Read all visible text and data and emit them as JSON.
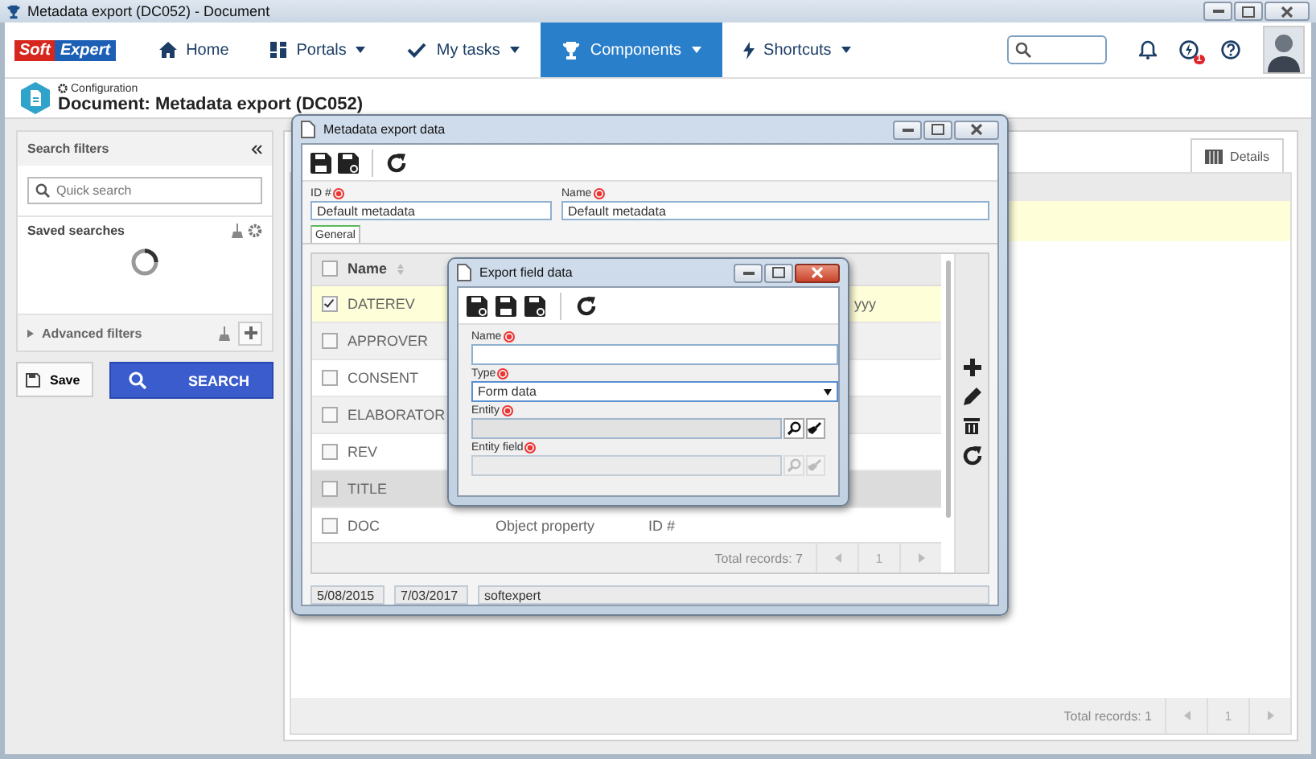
{
  "window": {
    "title": "Metadata export (DC052) - Document"
  },
  "logo": {
    "left": "Soft",
    "right": "Expert"
  },
  "nav": [
    {
      "kind": "home",
      "label": "Home",
      "menu": false,
      "selected": false
    },
    {
      "kind": "portals",
      "label": "Portals",
      "menu": true,
      "selected": false
    },
    {
      "kind": "tasks",
      "label": "My tasks",
      "menu": true,
      "selected": false
    },
    {
      "kind": "components",
      "label": "Components",
      "menu": true,
      "selected": true
    },
    {
      "kind": "shortcuts",
      "label": "Shortcuts",
      "menu": true,
      "selected": false
    }
  ],
  "notifications_badge": "1",
  "breadcrumb": "Configuration",
  "page_title": "Document: Metadata export (DC052)",
  "filters": {
    "title": "Search filters",
    "placeholder": "Quick search",
    "saved_searches": "Saved searches",
    "advanced": "Advanced filters",
    "advanced_expanded": false
  },
  "save_button": "Save",
  "search_button": "SEARCH",
  "details_tab": {
    "label": "Details",
    "selected": true
  },
  "main_grid": {
    "rows": [
      {
        "selected": true
      }
    ],
    "total": "Total records: 1",
    "page": "1"
  },
  "dialog": {
    "title": "Metadata export data",
    "id_label": "ID #",
    "id_value": "Default metadata",
    "name_label": "Name",
    "name_value": "Default metadata",
    "tabs": [
      {
        "label": "General",
        "selected": true
      }
    ],
    "all_checked": false,
    "columns": [
      "Name"
    ],
    "rows": [
      {
        "name": "DATEREV",
        "checked": true,
        "selected": true,
        "highlighted": false,
        "column_4": "yyy"
      },
      {
        "name": "APPROVER",
        "checked": false,
        "selected": false,
        "highlighted": false
      },
      {
        "name": "CONSENT",
        "checked": false,
        "selected": false,
        "highlighted": false
      },
      {
        "name": "ELABORATOR",
        "checked": false,
        "selected": false,
        "highlighted": false
      },
      {
        "name": "REV",
        "checked": false,
        "selected": false,
        "highlighted": false
      },
      {
        "name": "TITLE",
        "checked": false,
        "selected": false,
        "highlighted": true
      },
      {
        "name": "DOC",
        "checked": false,
        "selected": false,
        "highlighted": false,
        "column_2": "Object property",
        "column_3": "ID #"
      }
    ],
    "total": "Total records: 7",
    "page": "1",
    "footer_values": [
      "5/08/2015",
      "7/03/2017",
      "softexpert"
    ]
  },
  "subdialog": {
    "title": "Export field data",
    "fields": [
      {
        "kind": "text",
        "label": "Name",
        "required": true
      },
      {
        "kind": "select",
        "label": "Type",
        "required": true,
        "value": "Form data"
      },
      {
        "kind": "lookup",
        "label": "Entity",
        "required": true,
        "disabled": false
      },
      {
        "kind": "lookup",
        "label": "Entity field",
        "required": true,
        "disabled": true
      }
    ]
  }
}
